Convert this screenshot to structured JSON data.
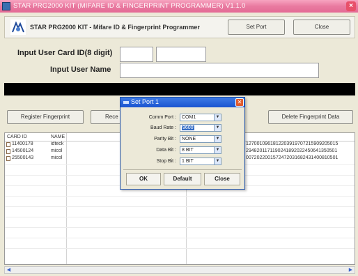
{
  "window": {
    "title": "STAR PRG2000 KIT (MIFARE ID & FINGERPRINT PROGRAMMER) V1.1.0"
  },
  "header": {
    "title": "STAR PRG2000 KIT - Mifare ID & Fingerprint Programmer",
    "set_port_label": "Set Port",
    "close_label": "Close"
  },
  "form": {
    "card_id_label": "Input User Card ID(8 digit)",
    "card_id_value_1": "",
    "card_id_value_2": "",
    "user_name_label": "Input User Name",
    "user_name_value": ""
  },
  "actions": {
    "register_label": "Register Fingerprint",
    "receive_label": "Rece",
    "delete_label": "Delete Fingerprint Data"
  },
  "table": {
    "columns": [
      "CARD ID",
      "NAME"
    ],
    "rows": [
      {
        "card_id": "11400178",
        "name": "idteck",
        "data": "1270010961812203919707215909205015"
      },
      {
        "card_id": "14500124",
        "name": "micol",
        "data": "2948201171190241892022450641350501"
      },
      {
        "card_id": "25500143",
        "name": "micol",
        "data": "0072022001572472031682431400810501"
      }
    ]
  },
  "dialog": {
    "title": "Set Port 1",
    "fields": [
      {
        "label": "Comm Port :",
        "value": "COM1"
      },
      {
        "label": "Baud Rate :",
        "value": "9600"
      },
      {
        "label": "Parity Bit :",
        "value": "NONE"
      },
      {
        "label": "Data Bit :",
        "value": "8 BIT"
      },
      {
        "label": "Stop Bit :",
        "value": "1 BIT"
      }
    ],
    "ok_label": "OK",
    "default_label": "Default",
    "close_label": "Close"
  }
}
